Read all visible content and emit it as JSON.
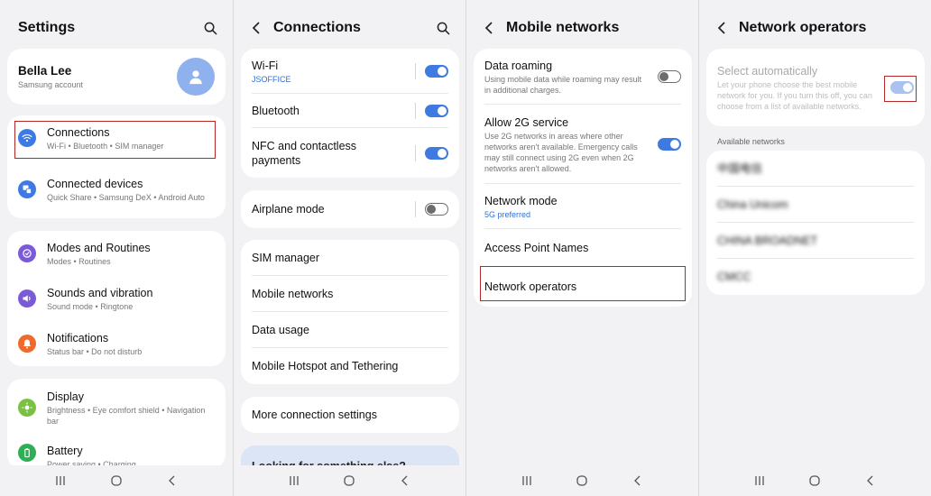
{
  "screen1": {
    "title": "Settings",
    "profile": {
      "name": "Bella Lee",
      "account": "Samsung account"
    },
    "items": [
      {
        "title": "Connections",
        "subtitle": "Wi-Fi  •  Bluetooth  •  SIM manager"
      },
      {
        "title": "Connected devices",
        "subtitle": "Quick Share  •  Samsung DeX  •  Android Auto"
      },
      {
        "title": "Modes and Routines",
        "subtitle": "Modes  •  Routines"
      },
      {
        "title": "Sounds and vibration",
        "subtitle": "Sound mode  •  Ringtone"
      },
      {
        "title": "Notifications",
        "subtitle": "Status bar  •  Do not disturb"
      },
      {
        "title": "Display",
        "subtitle": "Brightness  •  Eye comfort shield  •  Navigation bar"
      },
      {
        "title": "Battery",
        "subtitle": "Power saving  •  Charging"
      }
    ]
  },
  "screen2": {
    "title": "Connections",
    "items": [
      {
        "title": "Wi-Fi",
        "subtitle": "JSOFFICE",
        "toggle": "on"
      },
      {
        "title": "Bluetooth",
        "toggle": "on"
      },
      {
        "title": "NFC and contactless payments",
        "toggle": "on"
      },
      {
        "title": "Airplane mode",
        "toggle": "off"
      },
      {
        "title": "SIM manager"
      },
      {
        "title": "Mobile networks"
      },
      {
        "title": "Data usage"
      },
      {
        "title": "Mobile Hotspot and Tethering"
      },
      {
        "title": "More connection settings"
      }
    ],
    "peek_text": "Looking for something else?"
  },
  "screen3": {
    "title": "Mobile networks",
    "items": [
      {
        "title": "Data roaming",
        "subtitle": "Using mobile data while roaming may result in additional charges.",
        "toggle": "off"
      },
      {
        "title": "Allow 2G service",
        "subtitle": "Use 2G networks in areas where other networks aren't available. Emergency calls may still connect using 2G even when 2G networks aren't allowed.",
        "toggle": "on"
      },
      {
        "title": "Network mode",
        "subtitle": "5G preferred"
      },
      {
        "title": "Access Point Names"
      },
      {
        "title": "Network operators"
      }
    ]
  },
  "screen4": {
    "title": "Network operators",
    "select_auto": {
      "title": "Select automatically",
      "subtitle": "Let your phone choose the best mobile network for you. If you turn this off, you can choose from a list of available networks.",
      "toggle": "on"
    },
    "section_label": "Available networks",
    "networks": [
      "中国电信",
      "China Unicom",
      "CHINA BROADNET",
      "CMCC"
    ]
  },
  "colors": {
    "accent": "#3f7ae0",
    "highlight": "#b22828",
    "background": "#f2f2f4"
  },
  "icons": [
    "search-icon",
    "back-icon",
    "avatar-icon",
    "wifi-icon",
    "devices-icon",
    "routines-icon",
    "sound-icon",
    "notification-icon",
    "display-icon",
    "battery-icon",
    "recents-icon",
    "home-icon",
    "nav-back-icon"
  ]
}
